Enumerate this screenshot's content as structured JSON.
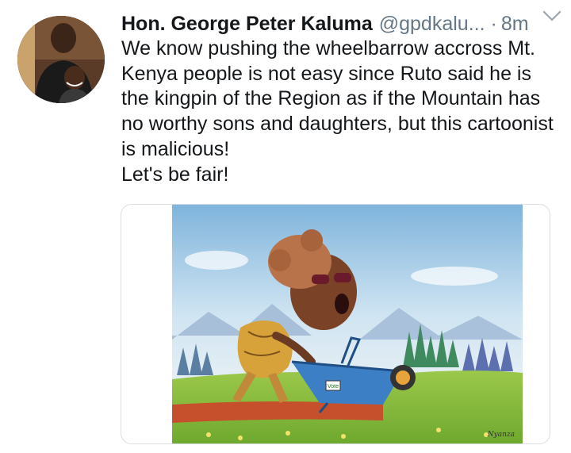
{
  "tweet": {
    "author_name": "Hon. George Peter Kaluma",
    "handle": "@gpdkalu...",
    "separator": "·",
    "time": "8m",
    "text": "We know pushing the wheelbarrow accross Mt. Kenya people is not easy since Ruto said he is the kingpin of the Region as if the Mountain has no worthy sons and daughters, but this cartoonist is malicious!\nLet's be fair!"
  },
  "icons": {
    "more": "chevron-down-icon",
    "avatar": "avatar-photo"
  },
  "media": {
    "wheelbarrow_label": "Vote",
    "signature": "Nyanza"
  },
  "colors": {
    "name": "#14171a",
    "secondary": "#657786",
    "card_border": "#d9dee2"
  }
}
